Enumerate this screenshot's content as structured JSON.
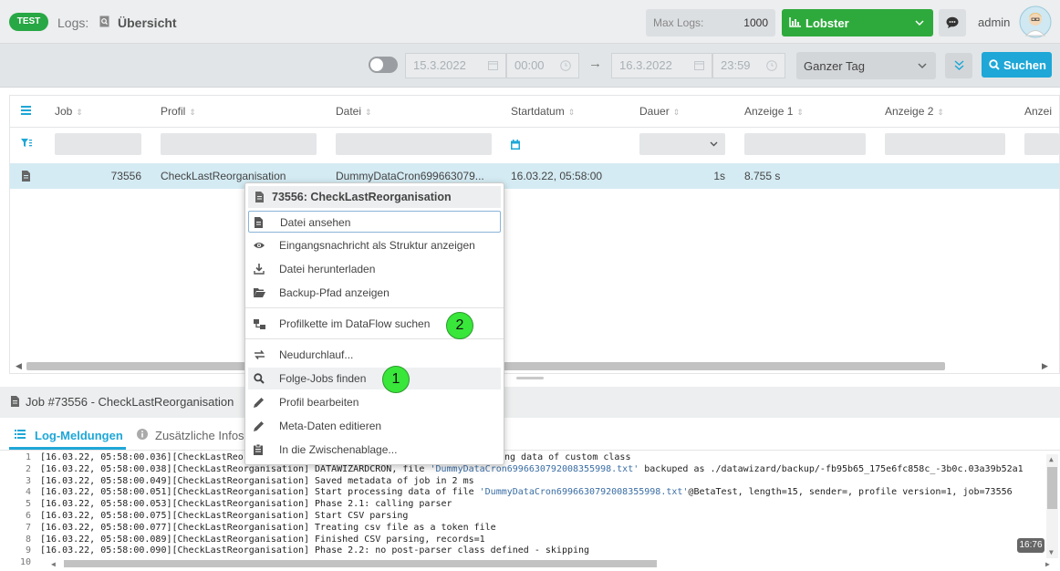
{
  "topbar": {
    "badge": "TEST",
    "crumb_prefix": "Logs:",
    "crumb_page": "Übersicht",
    "maxlogs_label": "Max Logs:",
    "maxlogs_value": "1000",
    "profile_select": "Lobster",
    "user": "admin"
  },
  "filter": {
    "date_from": "15.3.2022",
    "time_from": "00:00",
    "arrow": "→",
    "date_to": "16.3.2022",
    "time_to": "23:59",
    "range": "Ganzer Tag",
    "search_label": "Suchen"
  },
  "grid": {
    "headers": {
      "job": "Job",
      "profil": "Profil",
      "datei": "Datei",
      "start": "Startdatum",
      "dauer": "Dauer",
      "a1": "Anzeige 1",
      "a2": "Anzeige 2",
      "a3": "Anzei"
    },
    "row": {
      "job": "73556",
      "profil": "CheckLastReorganisation",
      "datei": "DummyDataCron699663079...",
      "start": "16.03.22, 05:58:00",
      "dauer": "1s",
      "a1": "8.755 s"
    }
  },
  "menu": {
    "title": "73556: CheckLastReorganisation",
    "items": [
      "Datei ansehen",
      "Eingangsnachricht als Struktur anzeigen",
      "Datei herunterladen",
      "Backup-Pfad anzeigen",
      "Profilkette im DataFlow suchen",
      "Neudurchlauf...",
      "Folge-Jobs finden",
      "Profil bearbeiten",
      "Meta-Daten editieren",
      "In die Zwischenablage..."
    ],
    "marker1": "1",
    "marker2": "2"
  },
  "details": {
    "job_title": "Job #73556 - CheckLastReorganisation",
    "tab_log": "Log-Meldungen",
    "tab_info": "Zusätzliche Infos",
    "cursor_pos": "16:76"
  },
  "log_lines": [
    {
      "n": "1",
      "a": "[16.03.22, 05:58:00.036][CheckLastReo",
      "b": "",
      "c": "",
      "tail": "ng data of custom class"
    },
    {
      "n": "2",
      "a": "[16.03.22, 05:58:00.038][CheckLastReorganisation] DATAWIZARDCRON, file ",
      "b": "'DummyDataCron6996630792008355998.txt'",
      "c": " backuped as ./datawizard/backup/-fb95b65_175e6fc858c_-3b0c.03a39b52a1"
    },
    {
      "n": "3",
      "a": "[16.03.22, 05:58:00.049][CheckLastReorganisation] Saved metadata of job in 2 ms",
      "b": "",
      "c": ""
    },
    {
      "n": "4",
      "a": "[16.03.22, 05:58:00.051][CheckLastReorganisation] Start processing data of file ",
      "b": "'DummyDataCron6996630792008355998.txt'",
      "c": "@BetaTest, length=15, sender=, profile version=1, job=73556"
    },
    {
      "n": "5",
      "a": "[16.03.22, 05:58:00.053][CheckLastReorganisation] Phase 2.1: calling parser",
      "b": "",
      "c": ""
    },
    {
      "n": "6",
      "a": "[16.03.22, 05:58:00.075][CheckLastReorganisation] Start CSV parsing",
      "b": "",
      "c": ""
    },
    {
      "n": "7",
      "a": "[16.03.22, 05:58:00.077][CheckLastReorganisation] Treating csv file as a token file",
      "b": "",
      "c": ""
    },
    {
      "n": "8",
      "a": "[16.03.22, 05:58:00.089][CheckLastReorganisation] Finished CSV parsing, records=1",
      "b": "",
      "c": ""
    },
    {
      "n": "9",
      "a": "[16.03.22, 05:58:00.090][CheckLastReorganisation] Phase 2.2: no post-parser class defined - skipping",
      "b": "",
      "c": ""
    },
    {
      "n": "10",
      "a": "",
      "b": "",
      "c": ""
    }
  ],
  "colors": {
    "accent": "#1ea7d7",
    "green": "#2eaa3c",
    "selected_row": "#d4ebf3"
  }
}
